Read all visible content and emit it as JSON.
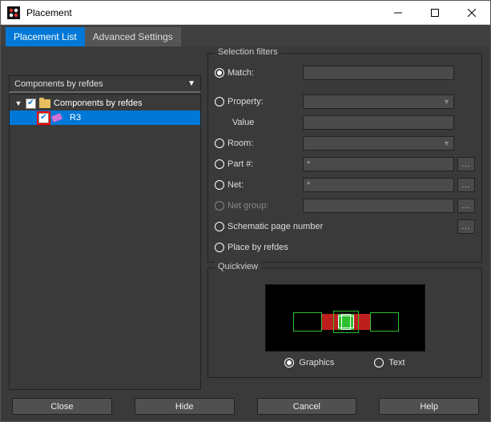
{
  "window": {
    "title": "Placement"
  },
  "tabs": {
    "placement_list": "Placement List",
    "advanced": "Advanced Settings"
  },
  "dropdown": {
    "value": "Components by refdes"
  },
  "tree": {
    "root": {
      "label": "Components by refdes"
    },
    "item1": {
      "label": "R3"
    }
  },
  "filters": {
    "group_title": "Selection filters",
    "match": "Match:",
    "property": "Property:",
    "value": "Value",
    "room": "Room:",
    "part": "Part #:",
    "net": "Net:",
    "netgroup": "Net group:",
    "schematic": "Schematic page number",
    "place_by_refdes": "Place by refdes",
    "part_value": "*",
    "net_value": "*"
  },
  "quickview": {
    "title": "Quickview",
    "graphics": "Graphics",
    "text": "Text"
  },
  "buttons": {
    "close": "Close",
    "hide": "Hide",
    "cancel": "Cancel",
    "help": "Help"
  },
  "more_label": "..."
}
